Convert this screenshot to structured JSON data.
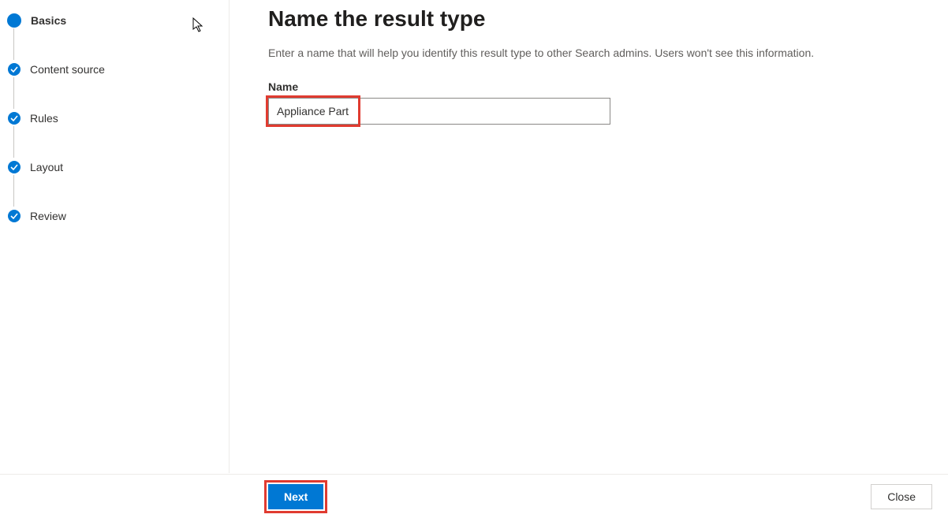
{
  "sidebar": {
    "steps": [
      {
        "label": "Basics",
        "state": "current"
      },
      {
        "label": "Content source",
        "state": "completed"
      },
      {
        "label": "Rules",
        "state": "completed"
      },
      {
        "label": "Layout",
        "state": "completed"
      },
      {
        "label": "Review",
        "state": "completed"
      }
    ]
  },
  "main": {
    "title": "Name the result type",
    "description": "Enter a name that will help you identify this result type to other Search admins. Users won't see this information.",
    "name_label": "Name",
    "name_value": "Appliance Part"
  },
  "footer": {
    "next_label": "Next",
    "close_label": "Close"
  }
}
